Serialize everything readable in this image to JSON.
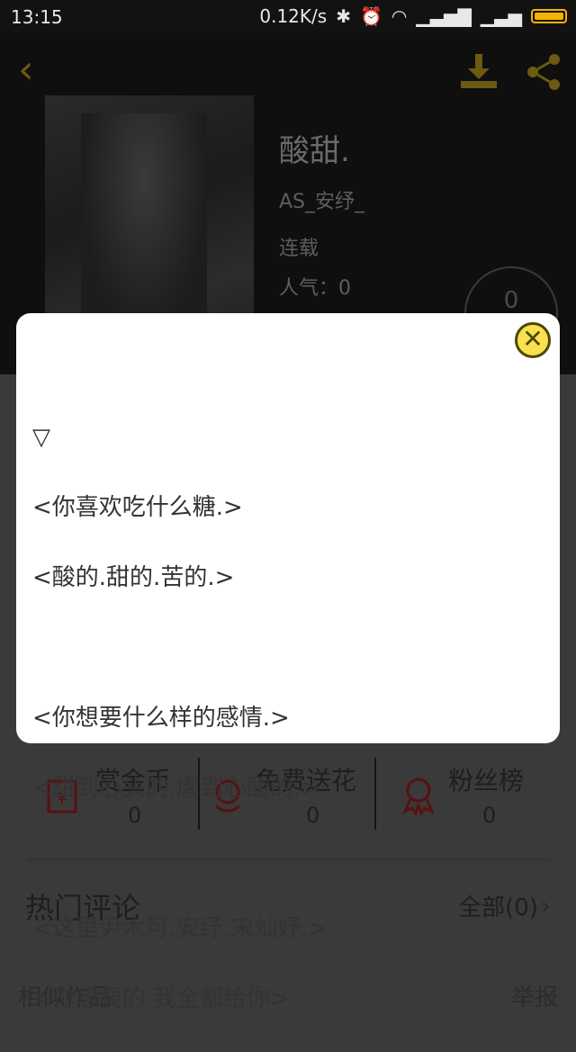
{
  "status_bar": {
    "time": "13:15",
    "speed": "0.12K/s"
  },
  "book": {
    "title": "酸甜.",
    "author": "AS_安纾_",
    "status": "连载",
    "popularity": "人气：0",
    "score": "0"
  },
  "dialog": {
    "close_symbol": "✕",
    "lines": [
      "▽",
      "<你喜欢吃什么糖.>",
      "<酸的.甜的.苦的.>",
      "",
      "<你想要什么样的感情.>",
      "<甜到心头的.虐到心酸的.>",
      "",
      "<这里尹木可.安纾.宋灿妤.>",
      "<你想要的.我全都给你>"
    ]
  },
  "actions": [
    {
      "label": "赏金币",
      "count": "0",
      "icon": "coin-icon"
    },
    {
      "label": "免费送花",
      "count": "0",
      "icon": "flower-icon"
    },
    {
      "label": "粉丝榜",
      "count": "0",
      "icon": "medal-icon"
    }
  ],
  "comments": {
    "title": "热门评论",
    "all_label": "全部(0)"
  },
  "footer": {
    "similar": "相似作品",
    "report": "举报"
  }
}
